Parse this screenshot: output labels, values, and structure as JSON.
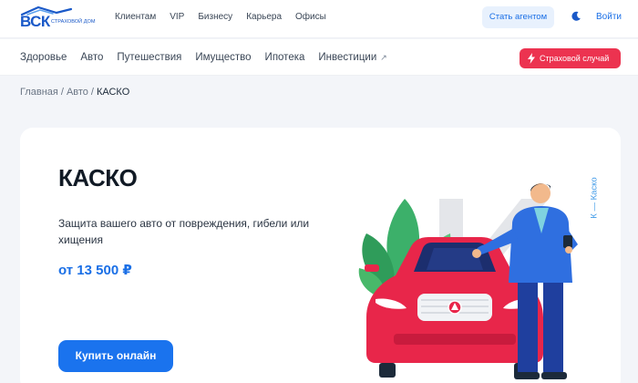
{
  "brand": {
    "logo_text": "ВСК",
    "logo_subtitle": "страховой дом"
  },
  "top_nav": [
    "Клиентам",
    "VIP",
    "Бизнесу",
    "Карьера",
    "Офисы"
  ],
  "header": {
    "agent_button": "Стать агентом",
    "login_label": "Войти"
  },
  "product_nav": [
    "Здоровье",
    "Авто",
    "Путешествия",
    "Имущество",
    "Ипотека",
    "Инвестиции"
  ],
  "claim_button": "Страховой случай",
  "breadcrumb": {
    "items": [
      "Главная",
      "Авто"
    ],
    "current": "КАСКО",
    "separator": "/"
  },
  "hero": {
    "title": "КАСКО",
    "description": "Защита вашего авто от повреждения, гибели или хищения",
    "price": "от 13 500 ₽",
    "cta": "Купить онлайн",
    "side_label": "К — Каско"
  },
  "colors": {
    "accent": "#1a73ee",
    "claim": "#ec3350",
    "car": "#e8264a",
    "background": "#f3f5f9"
  },
  "icons": [
    "moon-icon",
    "external-link-icon",
    "bolt-icon"
  ]
}
